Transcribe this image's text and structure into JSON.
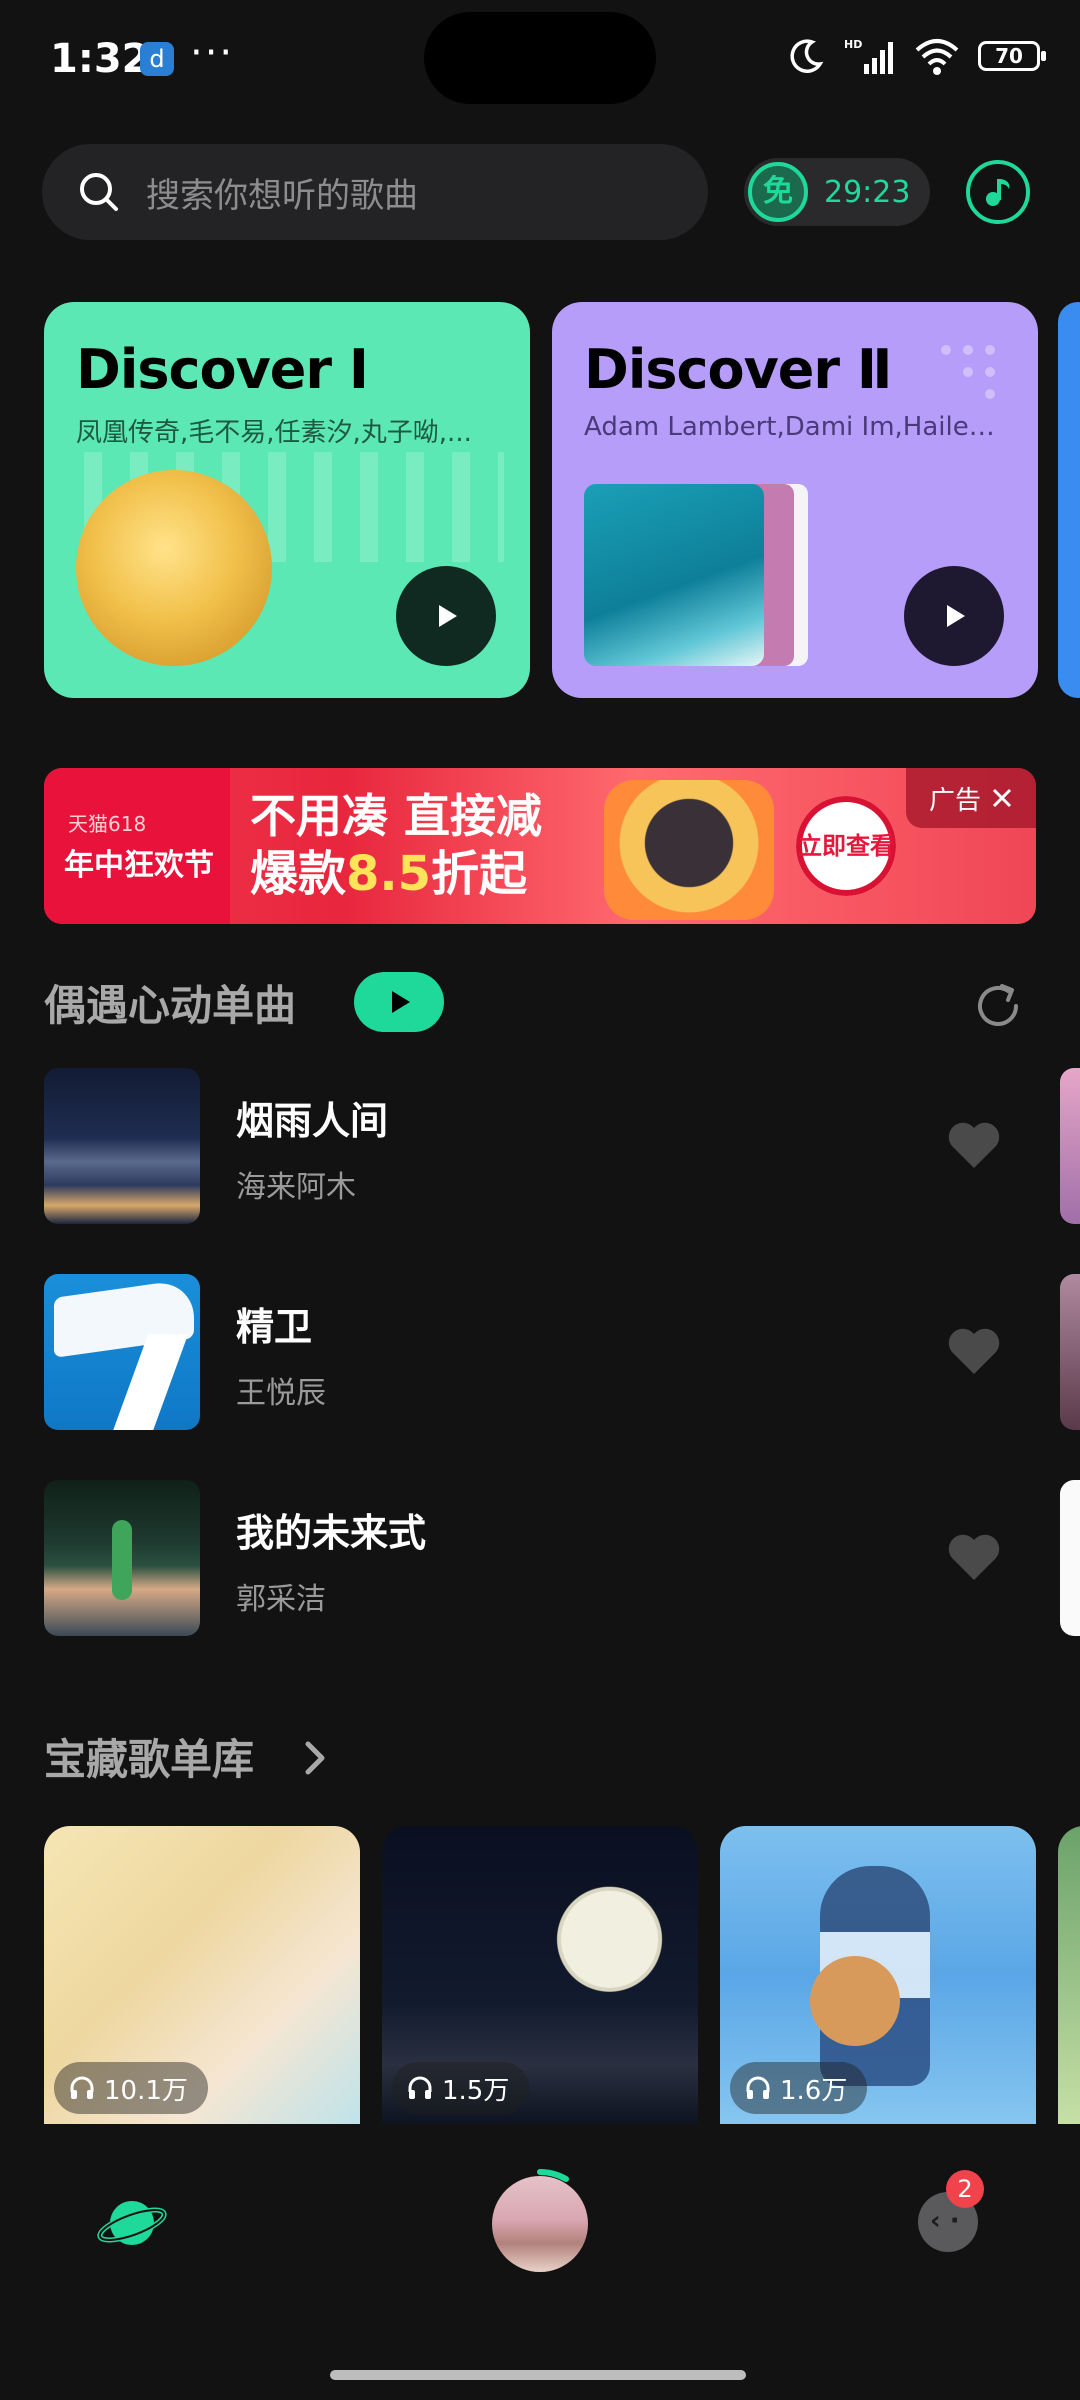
{
  "status": {
    "time": "1:32",
    "app_icon_letter": "d",
    "more": "···",
    "battery": "70"
  },
  "search": {
    "placeholder": "搜索你想听的歌曲"
  },
  "free": {
    "badge": "免",
    "time": "29:23"
  },
  "discover_cards": [
    {
      "title": "Discover Ⅰ",
      "subtitle": "凤凰传奇,毛不易,任素汐,丸子呦,..."
    },
    {
      "title": "Discover Ⅱ",
      "subtitle": "Adam Lambert,Dami Im,Hailey..."
    }
  ],
  "ad": {
    "brand": "天猫618",
    "event": "年中狂欢节",
    "line1": "不用凑 直接减",
    "line2_prefix": "爆款",
    "line2_value": "8.5",
    "line2_suffix": "折起",
    "cta": "立即查看",
    "tag": "广告"
  },
  "songs_section": {
    "title": "偶遇心动单曲",
    "items": [
      {
        "name": "烟雨人间",
        "artist": "海来阿木"
      },
      {
        "name": "精卫",
        "artist": "王悦辰"
      },
      {
        "name": "我的未来式",
        "artist": "郭采洁"
      }
    ]
  },
  "library_section": {
    "title": "宝藏歌单库",
    "playlists": [
      {
        "plays": "10.1万"
      },
      {
        "plays": "1.5万"
      },
      {
        "plays": "1.6万"
      }
    ]
  },
  "nav": {
    "badge": "2"
  },
  "colors": {
    "accent": "#1ed99a",
    "background": "#121212",
    "card1": "#5ce8b4",
    "card2": "#b79dfa"
  }
}
